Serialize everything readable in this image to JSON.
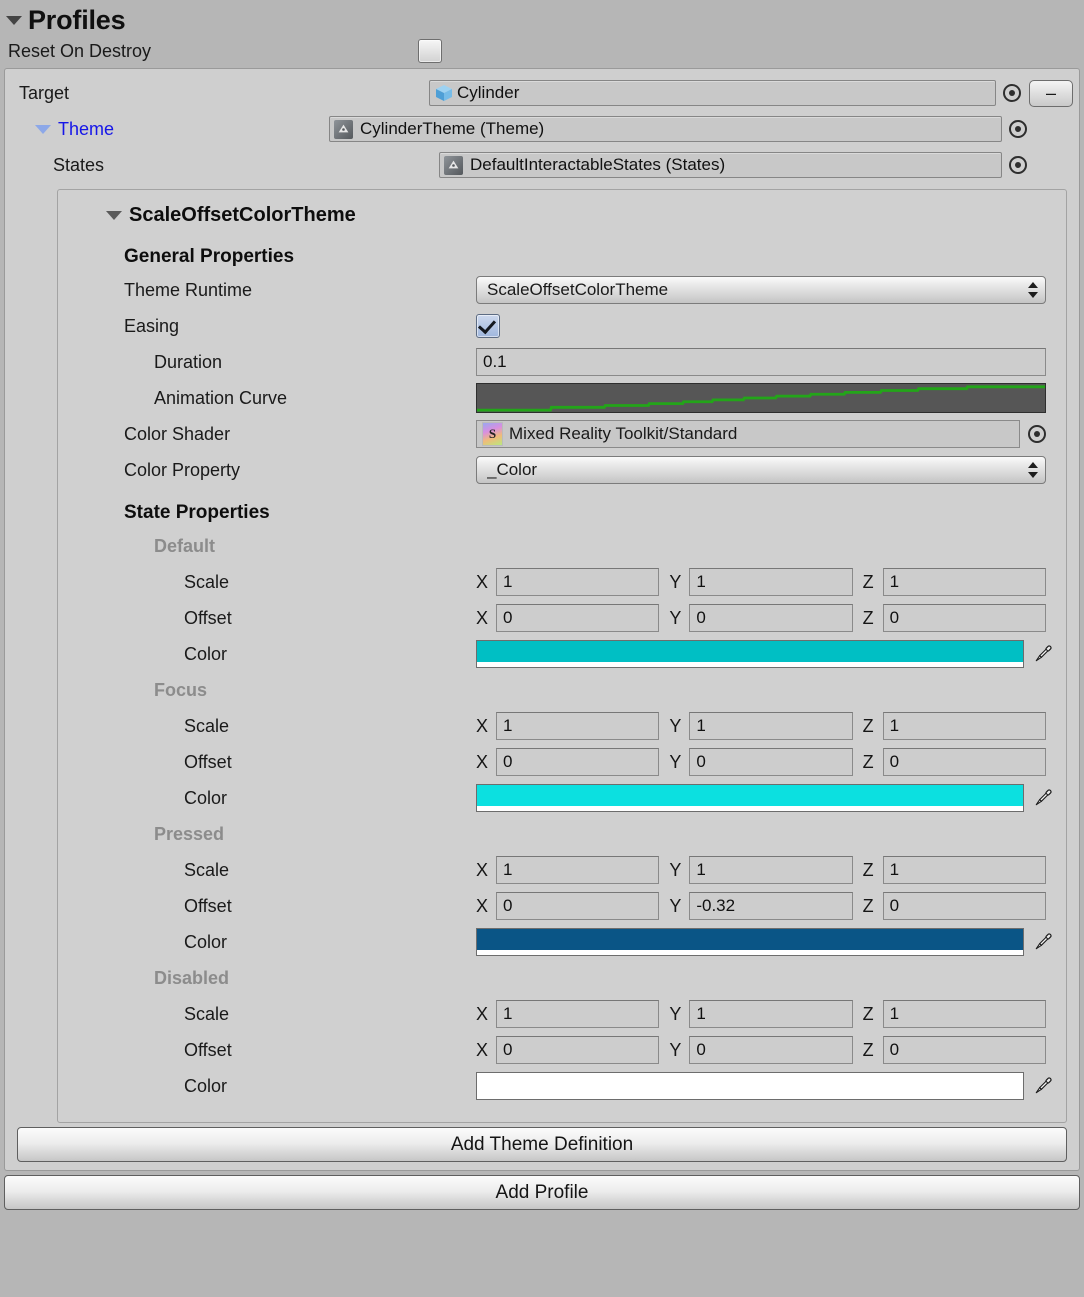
{
  "header": {
    "title": "Profiles",
    "foldout_icon": "triangle-down-icon",
    "reset_on_destroy_label": "Reset On Destroy",
    "reset_on_destroy_checked": false
  },
  "profile": {
    "target": {
      "label": "Target",
      "value": "Cylinder",
      "icon": "cube-icon",
      "picker_icon": "object-picker-icon",
      "remove_label": "–"
    },
    "theme": {
      "label": "Theme",
      "value": "CylinderTheme (Theme)",
      "icon": "unity-asset-icon",
      "picker_icon": "object-picker-icon",
      "label_color": "#1616e8"
    },
    "states": {
      "label": "States",
      "value": "DefaultInteractableStates (States)",
      "icon": "unity-asset-icon",
      "picker_icon": "object-picker-icon"
    }
  },
  "theme_definition": {
    "title": "ScaleOffsetColorTheme",
    "foldout_icon": "triangle-down-icon",
    "general_properties": {
      "heading": "General Properties",
      "theme_runtime": {
        "label": "Theme Runtime",
        "value": "ScaleOffsetColorTheme"
      },
      "easing": {
        "label": "Easing",
        "checked": true
      },
      "duration": {
        "label": "Duration",
        "value": "0.1"
      },
      "animation_curve": {
        "label": "Animation Curve",
        "curve_color": "#23a519",
        "background": "#565656"
      },
      "color_shader": {
        "label": "Color Shader",
        "value": "Mixed Reality Toolkit/Standard",
        "icon": "shader-icon",
        "picker_icon": "object-picker-icon"
      },
      "color_property": {
        "label": "Color Property",
        "value": "_Color"
      }
    },
    "state_properties": {
      "heading": "State Properties",
      "axis_labels": [
        "X",
        "Y",
        "Z"
      ],
      "row_labels": {
        "scale": "Scale",
        "offset": "Offset",
        "color": "Color"
      },
      "states": [
        {
          "name": "Default",
          "scale": [
            "1",
            "1",
            "1"
          ],
          "offset": [
            "0",
            "0",
            "0"
          ],
          "color": "#00bfc4"
        },
        {
          "name": "Focus",
          "scale": [
            "1",
            "1",
            "1"
          ],
          "offset": [
            "0",
            "0",
            "0"
          ],
          "color": "#0ce0e0"
        },
        {
          "name": "Pressed",
          "scale": [
            "1",
            "1",
            "1"
          ],
          "offset": [
            "0",
            "-0.32",
            "0"
          ],
          "color": "#0a5586"
        },
        {
          "name": "Disabled",
          "scale": [
            "1",
            "1",
            "1"
          ],
          "offset": [
            "0",
            "0",
            "0"
          ],
          "color": "#ffffff"
        }
      ]
    }
  },
  "buttons": {
    "add_theme_definition": "Add Theme Definition",
    "add_profile": "Add Profile"
  }
}
